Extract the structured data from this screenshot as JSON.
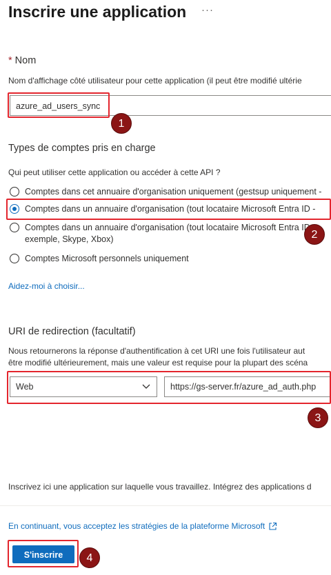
{
  "header": {
    "title": "Inscrire une application",
    "more_label": "···"
  },
  "name_section": {
    "required_mark": "*",
    "label": "Nom",
    "description": "Nom d'affichage côté utilisateur pour cette application (il peut être modifié ultérie",
    "input_value": "azure_ad_users_sync"
  },
  "account_types": {
    "heading": "Types de comptes pris en charge",
    "question": "Qui peut utiliser cette application ou accéder à cette API ?",
    "options": [
      {
        "line1": "Comptes dans cet annuaire d'organisation uniquement (gestsup uniquement -",
        "line2": "",
        "checked": false
      },
      {
        "line1": "Comptes dans un annuaire d'organisation (tout locataire Microsoft Entra ID -",
        "line2": "",
        "checked": true
      },
      {
        "line1": "Comptes dans un annuaire d'organisation (tout locataire Microsoft Entra ID -",
        "line2": "exemple, Skype, Xbox)",
        "checked": false
      },
      {
        "line1": "Comptes Microsoft personnels uniquement",
        "line2": "",
        "checked": false
      }
    ],
    "help_link": "Aidez-moi à choisir..."
  },
  "redirect": {
    "heading": "URI de redirection (facultatif)",
    "description_line1": "Nous retournerons la réponse d'authentification à cet URI une fois l'utilisateur aut",
    "description_line2": "être modifié ultérieurement, mais une valeur est requise pour la plupart des scéna",
    "platform_value": "Web",
    "uri_value": "https://gs-server.fr/azure_ad_auth.php"
  },
  "footer": {
    "info_text": "Inscrivez ici une application sur laquelle vous travaillez. Intégrez des applications d",
    "policy_link": "En continuant, vous acceptez les stratégies de la plateforme Microsoft",
    "register_button": "S'inscrire"
  },
  "annotations": {
    "badge1": "1",
    "badge2": "2",
    "badge3": "3",
    "badge4": "4",
    "color": "#e3252d",
    "badge_color": "#8b1515"
  },
  "colors": {
    "accent": "#0f6cbd",
    "required": "#a4262c"
  }
}
